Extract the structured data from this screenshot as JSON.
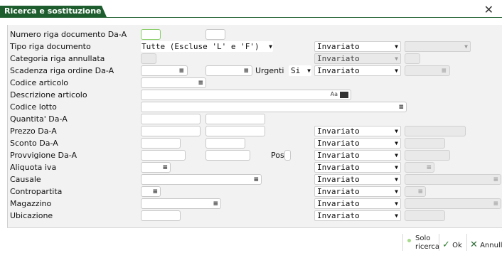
{
  "window": {
    "title": "Ricerca e sostituzione",
    "close_icon": "close-icon"
  },
  "rows": [
    {
      "label": "Numero riga documento Da-A"
    },
    {
      "label": "Tipo riga documento",
      "value": "Tutte (Escluse 'L' e 'F')",
      "action": "Invariato"
    },
    {
      "label": "Categoria riga annullata",
      "action": "Invariato"
    },
    {
      "label": "Scadenza riga ordine Da-A",
      "urgenti_label": "Urgenti",
      "urgenti_value": "Si",
      "action": "Invariato"
    },
    {
      "label": "Codice articolo"
    },
    {
      "label": "Descrizione articolo",
      "tools": "Aa"
    },
    {
      "label": "Codice lotto"
    },
    {
      "label": "Quantita' Da-A"
    },
    {
      "label": "Prezzo Da-A",
      "action": "Invariato"
    },
    {
      "label": "Sconto Da-A",
      "action": "Invariato"
    },
    {
      "label": "Provvigione Da-A",
      "pos_label": "Pos",
      "action": "Invariato"
    },
    {
      "label": "Aliquota iva",
      "action": "Invariato"
    },
    {
      "label": "Causale",
      "action": "Invariato"
    },
    {
      "label": "Contropartita",
      "action": "Invariato"
    },
    {
      "label": "Magazzino",
      "action": "Invariato"
    },
    {
      "label": "Ubicazione",
      "action": "Invariato"
    }
  ],
  "footer": {
    "solo_ricerca_line1": "Solo",
    "solo_ricerca_line2": "ricerca",
    "ok": "Ok",
    "annulla": "Annull"
  }
}
